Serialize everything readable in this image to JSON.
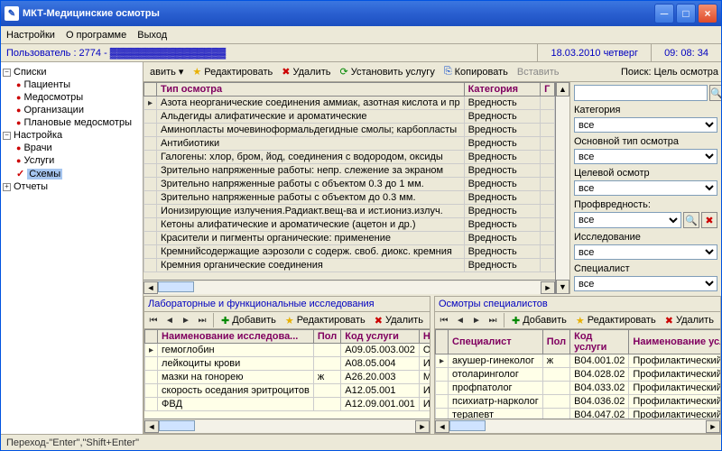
{
  "title": "МКТ-Медицинские осмотры",
  "menu": {
    "settings": "Настройки",
    "about": "О программе",
    "exit": "Выход"
  },
  "info": {
    "user": "Пользователь : 2774 - ▓▓▓▓▓▓▓▓▓▓▓▓▓▓▓▓",
    "date": "18.03.2010 четверг",
    "time": "09: 08: 34"
  },
  "tree": {
    "lists": "Списки",
    "patients": "Пациенты",
    "exams": "Медосмотры",
    "orgs": "Организации",
    "planned": "Плановые медосмотры",
    "setup": "Настройка",
    "doctors": "Врачи",
    "services": "Услуги",
    "schemes": "Схемы",
    "reports": "Отчеты"
  },
  "toolbar": {
    "add": "авить",
    "edit": "Редактировать",
    "del": "Удалить",
    "setsvc": "Установить услугу",
    "copy": "Копировать",
    "paste": "Вставить",
    "searchlbl": "Поиск: Цель осмотра"
  },
  "grid": {
    "col_type": "Тип осмотра",
    "col_cat": "Категория",
    "col_g": "Г",
    "rows": [
      {
        "t": "Азота неорганические соединения аммиак, азотная кислота и пр",
        "c": "Вредность"
      },
      {
        "t": "Альдегиды алифатические и ароматические",
        "c": "Вредность"
      },
      {
        "t": "Аминопласты мочевиноформальдегидные смолы; карбопласты",
        "c": "Вредность"
      },
      {
        "t": "Антибиотики",
        "c": "Вредность"
      },
      {
        "t": "Галогены: хлор, бром, йод, соединения с водородом, оксиды",
        "c": "Вредность"
      },
      {
        "t": "Зрительно напряженные работы: непр. слежение за экраном",
        "c": "Вредность"
      },
      {
        "t": "Зрительно напряженные работы с объектом 0.3 до 1 мм.",
        "c": "Вредность"
      },
      {
        "t": "Зрительно напряженные работы с объектом до 0.3 мм.",
        "c": "Вредность"
      },
      {
        "t": "Ионизирующие излучения.Радиакт.вещ-ва и ист.иониз.излуч.",
        "c": "Вредность"
      },
      {
        "t": "Кетоны алифатические и ароматические (ацетон и др.)",
        "c": "Вредность"
      },
      {
        "t": "Красители и пигменты органические: применение",
        "c": "Вредность"
      },
      {
        "t": "Кремнийсодержащие аэрозоли с содерж. своб. диокс. кремния",
        "c": "Вредность"
      },
      {
        "t": "Кремния органические соединения",
        "c": "Вредность"
      }
    ]
  },
  "filter": {
    "cat": "Категория",
    "all": "все",
    "maintype": "Основной тип осмотра",
    "target": "Целевой осмотр",
    "prof": "Профвредность:",
    "research": "Исследование",
    "spec": "Специалист"
  },
  "lab": {
    "title": "Лабораторные и функциональные исследования",
    "add": "Добавить",
    "edit": "Редактировать",
    "del": "Удалить",
    "col_name": "Наименование исследова...",
    "col_sex": "Пол",
    "col_code": "Код услуги",
    "col_n": "На",
    "rows": [
      {
        "n": "гемоглобин",
        "s": "",
        "c": "A09.05.003.002",
        "x": "Оп"
      },
      {
        "n": "лейкоциты крови",
        "s": "",
        "c": "A08.05.004",
        "x": "Ис"
      },
      {
        "n": "мазки на гонорею",
        "s": "ж",
        "c": "A26.20.003",
        "x": "Ми"
      },
      {
        "n": "скорость оседания эритроцитов",
        "s": "",
        "c": "A12.05.001",
        "x": "Ис"
      },
      {
        "n": "ФВД",
        "s": "",
        "c": "A12.09.001.001",
        "x": "Ис"
      }
    ]
  },
  "spec": {
    "title": "Осмотры специалистов",
    "add": "Добавить",
    "edit": "Редактировать",
    "del": "Удалить",
    "col_spec": "Специалист",
    "col_sex": "Пол",
    "col_code": "Код услуги",
    "col_svc": "Наименование услуг",
    "rows": [
      {
        "n": "акушер-гинеколог",
        "s": "ж",
        "c": "B04.001.02",
        "x": "Профилактический пр"
      },
      {
        "n": "отоларинголог",
        "s": "",
        "c": "B04.028.02",
        "x": "Профилактический пр"
      },
      {
        "n": "профпатолог",
        "s": "",
        "c": "B04.033.02",
        "x": "Профилактический пр"
      },
      {
        "n": "психиатр-нарколог",
        "s": "",
        "c": "B04.036.02",
        "x": "Профилактический пр"
      },
      {
        "n": "терапевт",
        "s": "",
        "c": "B04.047.02",
        "x": "Профилактический пр"
      }
    ]
  },
  "status": "Переход-\"Enter\",\"Shift+Enter\""
}
